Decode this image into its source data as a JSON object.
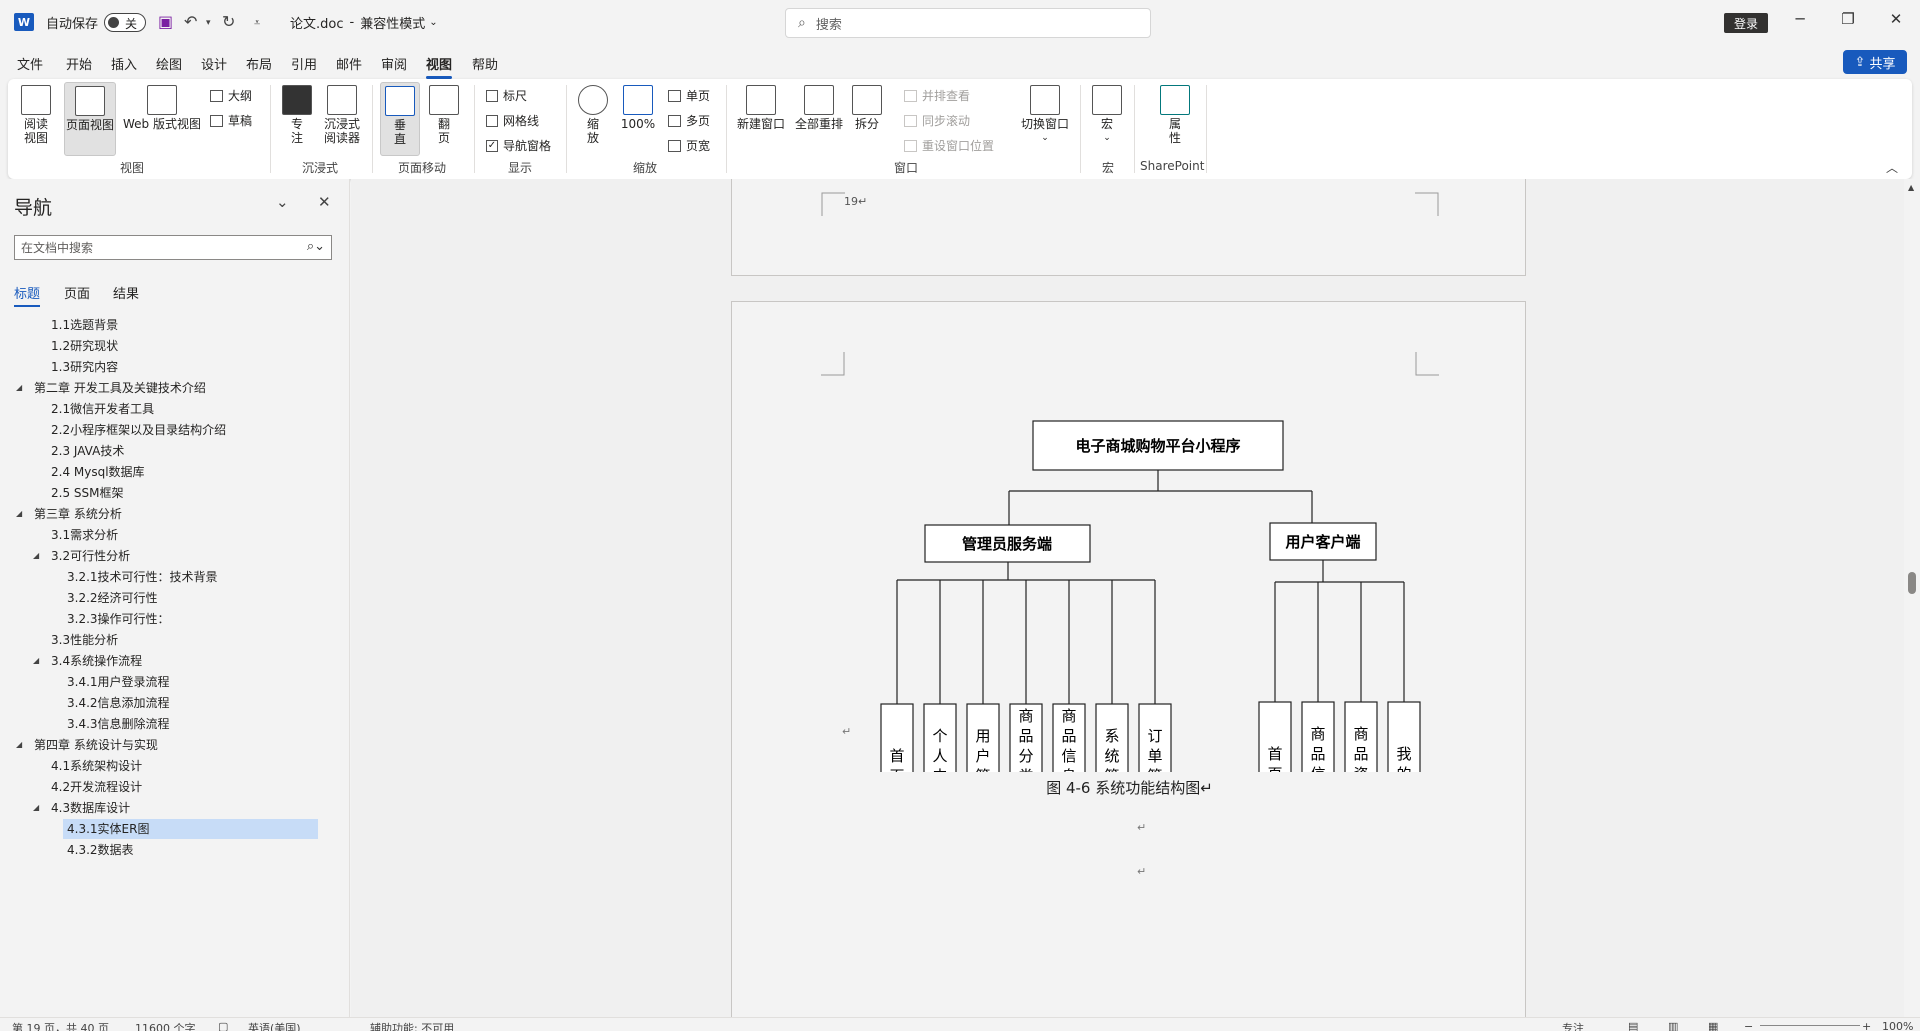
{
  "titlebar": {
    "logo": "W",
    "autosave_label": "自动保存",
    "autosave_state": "关",
    "doc_title": "论文.doc",
    "separator": "-",
    "mode": "兼容性模式",
    "search_placeholder": "搜索",
    "login_label": "登录"
  },
  "menu": [
    "文件",
    "开始",
    "插入",
    "绘图",
    "设计",
    "布局",
    "引用",
    "邮件",
    "审阅",
    "视图",
    "帮助"
  ],
  "share_label": "共享",
  "ribbon": {
    "read_view": "阅读\n视图",
    "print_layout": "页面视图",
    "web_layout": "Web 版式视图",
    "outline": "大纲",
    "draft": "草稿",
    "views_group": "视图",
    "focus": "专\n注",
    "immersive_reader": "沉浸式\n阅读器",
    "immersive_group": "沉浸式",
    "vertical": "垂\n直",
    "side_to_side": "翻\n页",
    "page_movement_group": "页面移动",
    "ruler": "标尺",
    "gridlines": "网格线",
    "nav_pane": "导航窗格",
    "show_group": "显示",
    "zoom": "缩\n放",
    "zoom_100": "100%",
    "one_page": "单页",
    "multiple_pages": "多页",
    "page_width": "页宽",
    "zoom_group": "缩放",
    "new_window": "新建窗口",
    "arrange_all": "全部重排",
    "split": "拆分",
    "view_side_by_side": "并排查看",
    "sync_scroll": "同步滚动",
    "reset_window": "重设窗口位置",
    "switch_windows": "切换窗口",
    "window_group": "窗口",
    "macros": "宏",
    "macros_group": "宏",
    "properties": "属\n性",
    "sharepoint_group": "SharePoint"
  },
  "nav": {
    "title": "导航",
    "search_placeholder": "在文档中搜索",
    "tabs": [
      "标题",
      "页面",
      "结果"
    ],
    "items": [
      {
        "label": "1.1选题背景",
        "level": 2,
        "toggle": ""
      },
      {
        "label": "1.2研究现状",
        "level": 2,
        "toggle": ""
      },
      {
        "label": "1.3研究内容",
        "level": 2,
        "toggle": ""
      },
      {
        "label": "第二章 开发工具及关键技术介绍",
        "level": 1,
        "toggle": "◢"
      },
      {
        "label": "2.1微信开发者工具",
        "level": 2,
        "toggle": ""
      },
      {
        "label": "2.2小程序框架以及目录结构介绍",
        "level": 2,
        "toggle": ""
      },
      {
        "label": "2.3 JAVA技术",
        "level": 2,
        "toggle": ""
      },
      {
        "label": "2.4   Mysql数据库",
        "level": 2,
        "toggle": ""
      },
      {
        "label": "2.5 SSM框架",
        "level": 2,
        "toggle": ""
      },
      {
        "label": "第三章 系统分析",
        "level": 1,
        "toggle": "◢"
      },
      {
        "label": "3.1需求分析",
        "level": 2,
        "toggle": ""
      },
      {
        "label": "3.2可行性分析",
        "level": 2,
        "toggle": "◢"
      },
      {
        "label": "3.2.1技术可行性：技术背景",
        "level": 3,
        "toggle": ""
      },
      {
        "label": "3.2.2经济可行性",
        "level": 3,
        "toggle": ""
      },
      {
        "label": "3.2.3操作可行性：",
        "level": 3,
        "toggle": ""
      },
      {
        "label": "3.3性能分析",
        "level": 2,
        "toggle": ""
      },
      {
        "label": "3.4系统操作流程",
        "level": 2,
        "toggle": "◢"
      },
      {
        "label": "3.4.1用户登录流程",
        "level": 3,
        "toggle": ""
      },
      {
        "label": "3.4.2信息添加流程",
        "level": 3,
        "toggle": ""
      },
      {
        "label": "3.4.3信息删除流程",
        "level": 3,
        "toggle": ""
      },
      {
        "label": "第四章 系统设计与实现",
        "level": 1,
        "toggle": "◢"
      },
      {
        "label": "4.1系统架构设计",
        "level": 2,
        "toggle": ""
      },
      {
        "label": "4.2开发流程设计",
        "level": 2,
        "toggle": ""
      },
      {
        "label": "4.3数据库设计",
        "level": 2,
        "toggle": "◢"
      },
      {
        "label": "4.3.1实体ER图",
        "level": 3,
        "toggle": "",
        "selected": true
      },
      {
        "label": "4.3.2数据表",
        "level": 3,
        "toggle": ""
      }
    ]
  },
  "document": {
    "page_number": "19↵",
    "diagram": {
      "root": "电子商城购物平台小程序",
      "admin": "管理员服务端",
      "user": "用户客户端",
      "admin_children": [
        "首页",
        "个人中心",
        "用户管理",
        "商品分类管理",
        "商品信息管理",
        "系统管理",
        "订单管理"
      ],
      "user_children": [
        "首页",
        "商品信息",
        "商品资讯",
        "我的"
      ]
    },
    "caption": "图 4-6 系统功能结构图↵",
    "para_mark": "↵"
  },
  "status": {
    "page": "第 19 页，共 40 页",
    "words": "11600 个字",
    "lang": "英语(美国)",
    "accessibility": "辅助功能: 不可用",
    "focus": "专注",
    "zoom": "100%"
  }
}
